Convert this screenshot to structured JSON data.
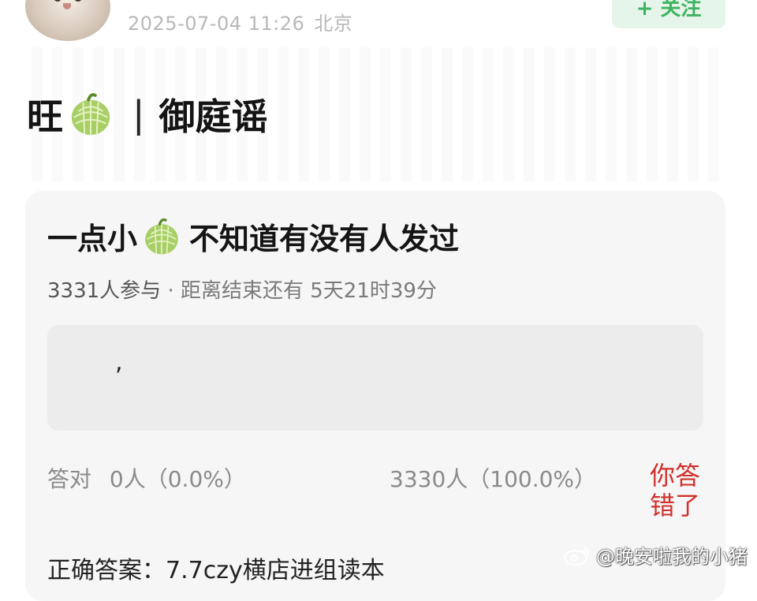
{
  "header": {
    "timestamp": "2025-07-04 11:26",
    "location": "北京",
    "follow_label": "+ 关注"
  },
  "post": {
    "title_prefix": "旺",
    "title_separator": "|",
    "title_suffix": "御庭谣"
  },
  "poll": {
    "title_prefix": "一点小",
    "title_suffix": "不知道有没有人发过",
    "participants": "3331人参与",
    "separator": "·",
    "remaining_label": "距离结束还有",
    "remaining_time": "5天21时39分",
    "answer_text": ",",
    "correct_label": "答对",
    "correct_count": "0人（0.0%）",
    "wrong_count": "3330人（100.0%）",
    "result_label": "你答错了",
    "correct_answer_label": "正确答案：",
    "correct_answer_value": "7.7czy横店进组读本"
  },
  "watermark": {
    "text": "@晚安啦我的小猪"
  },
  "colors": {
    "follow_bg": "#e6f5ea",
    "follow_text": "#3cb35f",
    "wrong_red": "#d0312d",
    "card_bg": "#f6f6f6"
  },
  "icons": [
    "avatar",
    "melon-icon",
    "weibo-icon"
  ]
}
